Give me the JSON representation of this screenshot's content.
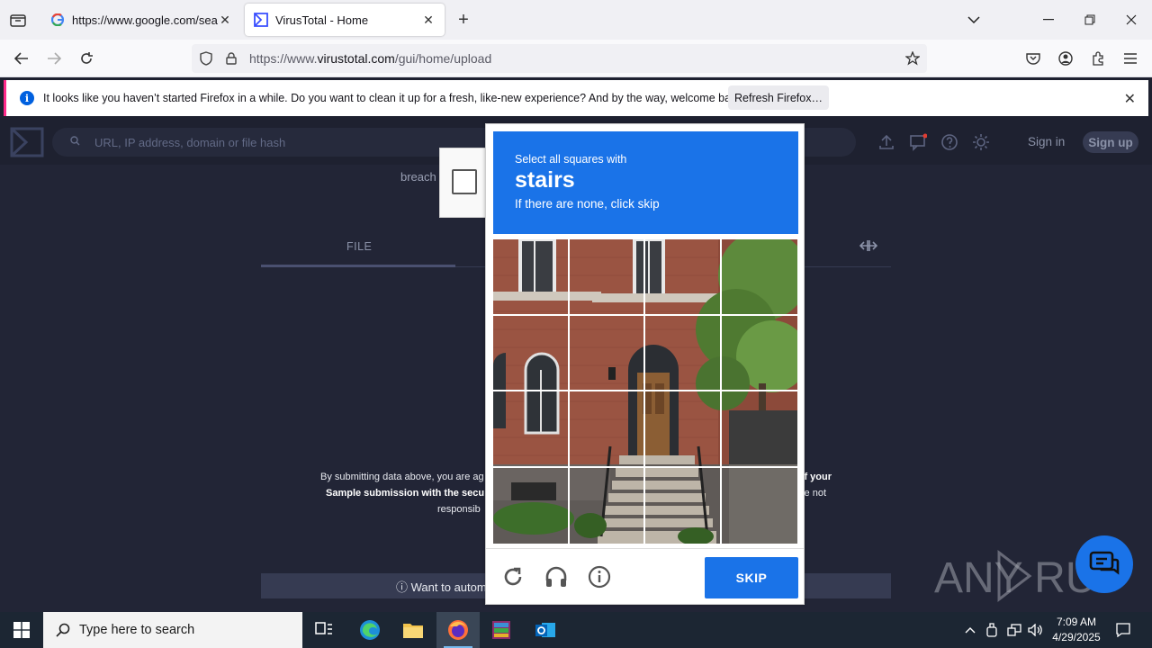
{
  "browser": {
    "tabs": [
      {
        "title": "https://www.google.com/search",
        "favicon": "google-g-icon",
        "active": false
      },
      {
        "title": "VirusTotal - Home",
        "favicon": "virustotal-icon",
        "active": true
      }
    ],
    "url_prefix": "https://www.",
    "url_domain": "virustotal.com",
    "url_path": "/gui/home/upload"
  },
  "notification": {
    "message": "It looks like you haven’t started Firefox in a while. Do you want to clean it up for a fresh, like-new experience? And by the way, welcome back!",
    "button": "Refresh Firefox…"
  },
  "vt": {
    "search_placeholder": "URL, IP address, domain or file hash",
    "sign_in": "Sign in",
    "sign_up": "Sign up",
    "breach_partial": "breach",
    "tab_file": "FILE",
    "terms_part1": "By submitting data above, you are ag",
    "terms_part1_right": "of your",
    "terms_part2": "Sample submission with the secu",
    "terms_part2_right": "e not",
    "terms_part3": "responsib",
    "automate": "Want to automat"
  },
  "captcha": {
    "line1": "Select all squares with",
    "target": "stairs",
    "line3": "If there are none, click skip",
    "skip": "SKIP"
  },
  "watermark": "ANY RUN",
  "taskbar": {
    "search_placeholder": "Type here to search",
    "time": "7:09 AM",
    "date": "4/29/2025"
  },
  "colors": {
    "captcha_blue": "#1a73e8",
    "vt_bg": "#222536",
    "notif_accent": "#ff2a8a"
  }
}
